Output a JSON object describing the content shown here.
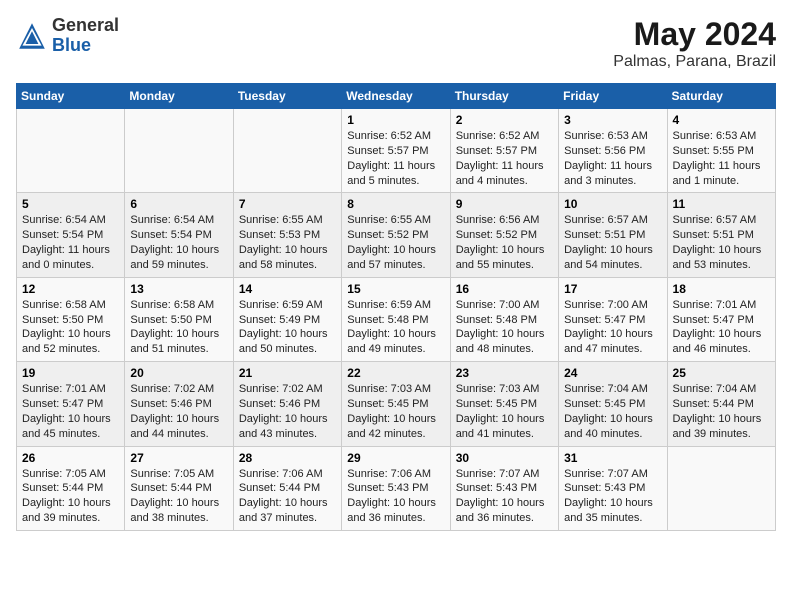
{
  "header": {
    "logo_general": "General",
    "logo_blue": "Blue",
    "title": "May 2024",
    "subtitle": "Palmas, Parana, Brazil"
  },
  "days_of_week": [
    "Sunday",
    "Monday",
    "Tuesday",
    "Wednesday",
    "Thursday",
    "Friday",
    "Saturday"
  ],
  "weeks": [
    [
      {
        "day": "",
        "info": ""
      },
      {
        "day": "",
        "info": ""
      },
      {
        "day": "",
        "info": ""
      },
      {
        "day": "1",
        "info": "Sunrise: 6:52 AM\nSunset: 5:57 PM\nDaylight: 11 hours\nand 5 minutes."
      },
      {
        "day": "2",
        "info": "Sunrise: 6:52 AM\nSunset: 5:57 PM\nDaylight: 11 hours\nand 4 minutes."
      },
      {
        "day": "3",
        "info": "Sunrise: 6:53 AM\nSunset: 5:56 PM\nDaylight: 11 hours\nand 3 minutes."
      },
      {
        "day": "4",
        "info": "Sunrise: 6:53 AM\nSunset: 5:55 PM\nDaylight: 11 hours\nand 1 minute."
      }
    ],
    [
      {
        "day": "5",
        "info": "Sunrise: 6:54 AM\nSunset: 5:54 PM\nDaylight: 11 hours\nand 0 minutes."
      },
      {
        "day": "6",
        "info": "Sunrise: 6:54 AM\nSunset: 5:54 PM\nDaylight: 10 hours\nand 59 minutes."
      },
      {
        "day": "7",
        "info": "Sunrise: 6:55 AM\nSunset: 5:53 PM\nDaylight: 10 hours\nand 58 minutes."
      },
      {
        "day": "8",
        "info": "Sunrise: 6:55 AM\nSunset: 5:52 PM\nDaylight: 10 hours\nand 57 minutes."
      },
      {
        "day": "9",
        "info": "Sunrise: 6:56 AM\nSunset: 5:52 PM\nDaylight: 10 hours\nand 55 minutes."
      },
      {
        "day": "10",
        "info": "Sunrise: 6:57 AM\nSunset: 5:51 PM\nDaylight: 10 hours\nand 54 minutes."
      },
      {
        "day": "11",
        "info": "Sunrise: 6:57 AM\nSunset: 5:51 PM\nDaylight: 10 hours\nand 53 minutes."
      }
    ],
    [
      {
        "day": "12",
        "info": "Sunrise: 6:58 AM\nSunset: 5:50 PM\nDaylight: 10 hours\nand 52 minutes."
      },
      {
        "day": "13",
        "info": "Sunrise: 6:58 AM\nSunset: 5:50 PM\nDaylight: 10 hours\nand 51 minutes."
      },
      {
        "day": "14",
        "info": "Sunrise: 6:59 AM\nSunset: 5:49 PM\nDaylight: 10 hours\nand 50 minutes."
      },
      {
        "day": "15",
        "info": "Sunrise: 6:59 AM\nSunset: 5:48 PM\nDaylight: 10 hours\nand 49 minutes."
      },
      {
        "day": "16",
        "info": "Sunrise: 7:00 AM\nSunset: 5:48 PM\nDaylight: 10 hours\nand 48 minutes."
      },
      {
        "day": "17",
        "info": "Sunrise: 7:00 AM\nSunset: 5:47 PM\nDaylight: 10 hours\nand 47 minutes."
      },
      {
        "day": "18",
        "info": "Sunrise: 7:01 AM\nSunset: 5:47 PM\nDaylight: 10 hours\nand 46 minutes."
      }
    ],
    [
      {
        "day": "19",
        "info": "Sunrise: 7:01 AM\nSunset: 5:47 PM\nDaylight: 10 hours\nand 45 minutes."
      },
      {
        "day": "20",
        "info": "Sunrise: 7:02 AM\nSunset: 5:46 PM\nDaylight: 10 hours\nand 44 minutes."
      },
      {
        "day": "21",
        "info": "Sunrise: 7:02 AM\nSunset: 5:46 PM\nDaylight: 10 hours\nand 43 minutes."
      },
      {
        "day": "22",
        "info": "Sunrise: 7:03 AM\nSunset: 5:45 PM\nDaylight: 10 hours\nand 42 minutes."
      },
      {
        "day": "23",
        "info": "Sunrise: 7:03 AM\nSunset: 5:45 PM\nDaylight: 10 hours\nand 41 minutes."
      },
      {
        "day": "24",
        "info": "Sunrise: 7:04 AM\nSunset: 5:45 PM\nDaylight: 10 hours\nand 40 minutes."
      },
      {
        "day": "25",
        "info": "Sunrise: 7:04 AM\nSunset: 5:44 PM\nDaylight: 10 hours\nand 39 minutes."
      }
    ],
    [
      {
        "day": "26",
        "info": "Sunrise: 7:05 AM\nSunset: 5:44 PM\nDaylight: 10 hours\nand 39 minutes."
      },
      {
        "day": "27",
        "info": "Sunrise: 7:05 AM\nSunset: 5:44 PM\nDaylight: 10 hours\nand 38 minutes."
      },
      {
        "day": "28",
        "info": "Sunrise: 7:06 AM\nSunset: 5:44 PM\nDaylight: 10 hours\nand 37 minutes."
      },
      {
        "day": "29",
        "info": "Sunrise: 7:06 AM\nSunset: 5:43 PM\nDaylight: 10 hours\nand 36 minutes."
      },
      {
        "day": "30",
        "info": "Sunrise: 7:07 AM\nSunset: 5:43 PM\nDaylight: 10 hours\nand 36 minutes."
      },
      {
        "day": "31",
        "info": "Sunrise: 7:07 AM\nSunset: 5:43 PM\nDaylight: 10 hours\nand 35 minutes."
      },
      {
        "day": "",
        "info": ""
      }
    ]
  ]
}
